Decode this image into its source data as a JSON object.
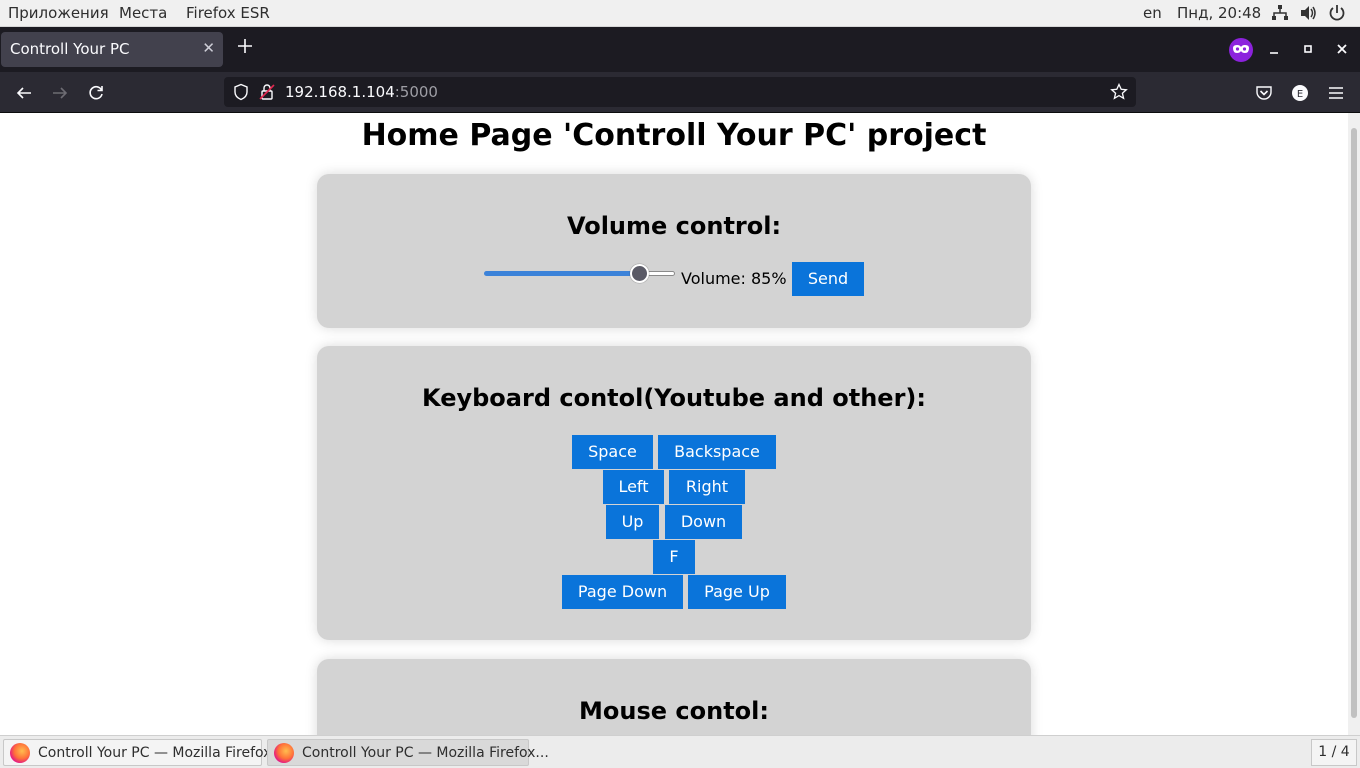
{
  "topbar": {
    "menu_apps": "Приложения",
    "menu_places": "Места",
    "menu_app": "Firefox ESR",
    "lang": "en",
    "clock": "Пнд, 20:48"
  },
  "browser": {
    "tab_title": "Controll Your PC",
    "url_host": "192.168.1.104",
    "url_port": ":5000"
  },
  "page": {
    "title": "Home Page 'Controll Your PC' project",
    "volume": {
      "heading": "Volume control:",
      "value": 85,
      "label": "Volume: 85%",
      "send_label": "Send"
    },
    "keyboard": {
      "heading": "Keyboard contol(Youtube and other):",
      "space": "Space",
      "backspace": "Backspace",
      "left": "Left",
      "right": "Right",
      "up": "Up",
      "down": "Down",
      "f": "F",
      "page_down": "Page Down",
      "page_up": "Page Up"
    },
    "mouse": {
      "heading": "Mouse contol:"
    }
  },
  "taskbar": {
    "task1": "Controll Your PC — Mozilla Firefox",
    "task2": "Controll Your PC — Mozilla Firefox...",
    "workspace": "1 / 4"
  },
  "colors": {
    "button_bg": "#0a74da",
    "card_bg": "#d3d3d3",
    "private_badge": "#8c22dd"
  }
}
